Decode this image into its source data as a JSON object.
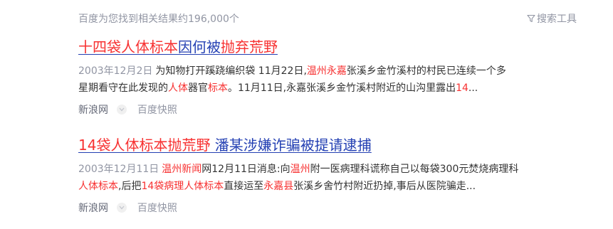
{
  "header": {
    "result_count": "百度为您找到相关结果约196,000个",
    "search_tools": "搜索工具"
  },
  "results": [
    {
      "title_parts": [
        {
          "text": "十四袋人体标本",
          "hl": true
        },
        {
          "text": "因何被",
          "hl": false
        },
        {
          "text": "抛弃荒野",
          "hl": true
        }
      ],
      "date": "2003年12月2日",
      "abstract_line1": [
        {
          "text": "为知物打开蹊跷编织袋 11月22日,",
          "hl": false
        },
        {
          "text": "温州",
          "hl": true
        },
        {
          "text": "永嘉",
          "hl": true
        },
        {
          "text": "张溪乡金竹溪村的村民已连续一个多",
          "hl": false
        }
      ],
      "abstract_line2": [
        {
          "text": "星期看守在此发现的",
          "hl": false
        },
        {
          "text": "人体",
          "hl": true
        },
        {
          "text": "器官",
          "hl": false
        },
        {
          "text": "标本",
          "hl": true
        },
        {
          "text": "。11月11日,永嘉张溪乡金竹溪村附近的山沟里露出",
          "hl": false
        },
        {
          "text": "14",
          "hl": true
        },
        {
          "text": "...",
          "hl": false
        }
      ],
      "source": "新浪网",
      "snapshot": "百度快照"
    },
    {
      "title_parts": [
        {
          "text": "14袋人体标本抛荒野",
          "hl": true
        },
        {
          "text": " 潘某涉嫌诈骗被提请逮捕",
          "hl": false
        }
      ],
      "date": "2003年12月11日",
      "abstract_line1": [
        {
          "text": "温州",
          "hl": true
        },
        {
          "text": "新闻",
          "hl": true
        },
        {
          "text": "网12月11日消息:向",
          "hl": false
        },
        {
          "text": "温州",
          "hl": true
        },
        {
          "text": "附一医病理科谎称自己以每袋300元焚烧病理科",
          "hl": false
        }
      ],
      "abstract_line2": [
        {
          "text": "人体标本",
          "hl": true
        },
        {
          "text": ",后把",
          "hl": false
        },
        {
          "text": "14袋病理人体标本",
          "hl": true
        },
        {
          "text": "直接运至",
          "hl": false
        },
        {
          "text": "永嘉县",
          "hl": true
        },
        {
          "text": "张溪乡舍竹村附近扔掉,事后从医院骗走...",
          "hl": false
        }
      ],
      "source": "新浪网",
      "snapshot": "百度快照"
    }
  ],
  "colors": {
    "link": "#2440b3",
    "highlight": "#f73131",
    "muted": "#9195a3"
  }
}
